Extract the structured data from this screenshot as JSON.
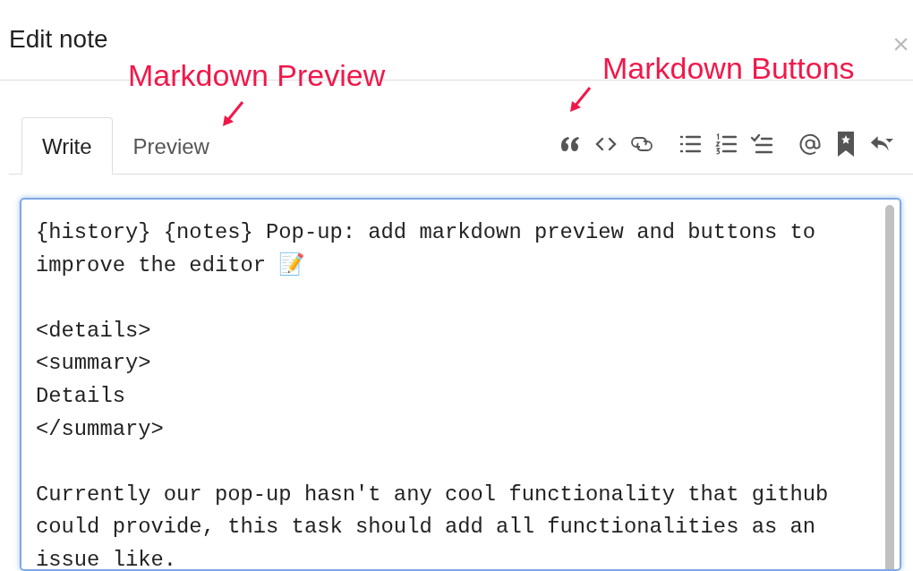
{
  "dialog": {
    "title": "Edit note",
    "close": "×"
  },
  "tabs": [
    {
      "label": "Write",
      "selected": true
    },
    {
      "label": "Preview",
      "selected": false
    }
  ],
  "editor": {
    "paragraphs": [
      [
        "{history} {notes} Pop-up: add markdown preview and buttons to",
        "improve the editor 📝"
      ],
      [
        "<details>",
        "<summary>",
        "Details",
        "</summary>"
      ],
      [
        "Currently our pop-up hasn't any cool functionality that github",
        "could provide, this task should add all functionalities as an",
        "issue like."
      ]
    ]
  },
  "annotations": [
    {
      "text": "Markdown Preview"
    },
    {
      "text": "Markdown Buttons"
    }
  ]
}
